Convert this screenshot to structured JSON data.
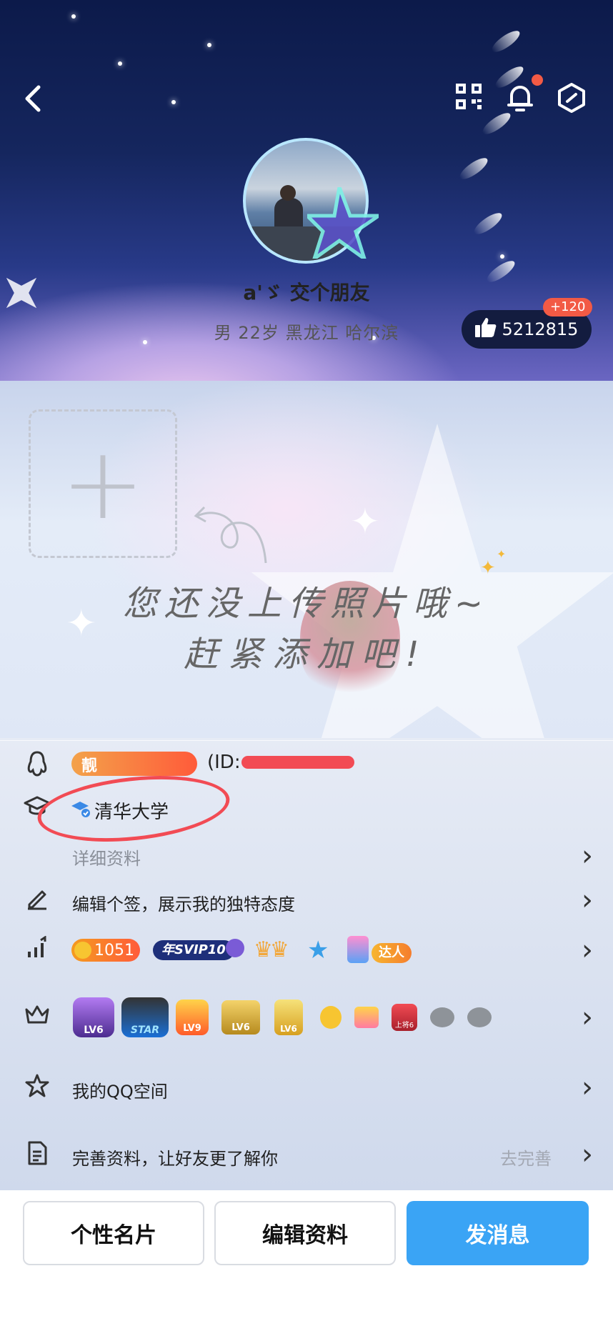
{
  "header": {
    "nickname": "a'ゞ 交个朋友",
    "subinfo": "男  22岁  黑龙江 哈尔滨",
    "likes_count": "5212815",
    "likes_badge": "+120",
    "icons": [
      "back-icon",
      "qr-code-icon",
      "bell-icon",
      "settings-hexagon-icon",
      "thumbs-up-icon"
    ],
    "colors": {
      "notification_dot": "#f25a45",
      "likes_pill": "#131c3f"
    }
  },
  "photos": {
    "upload_hint_line1": "您还没上传照片哦~",
    "upload_hint_line2": "赶紧添加吧!",
    "plus": "+"
  },
  "profile": {
    "qq_badge": "靓",
    "id_label": "(ID:",
    "school": "清华大学",
    "details_link": "详细资料",
    "signature_prompt": "编辑个签，展示我的独特态度",
    "level_value": "1051",
    "svip_label": "年SVIP10",
    "talent_label": "达人",
    "qzone": "我的QQ空间",
    "complete_profile": "完善资料，让好友更了解你",
    "complete_action": "去完善",
    "game_badges": [
      "LV6",
      "STAR",
      "LV9",
      "LV6",
      "LV6",
      "上将6"
    ]
  },
  "footer": {
    "card_button": "个性名片",
    "edit_button": "编辑资料",
    "message_button": "发消息",
    "colors": {
      "primary": "#3aa4f5"
    }
  }
}
